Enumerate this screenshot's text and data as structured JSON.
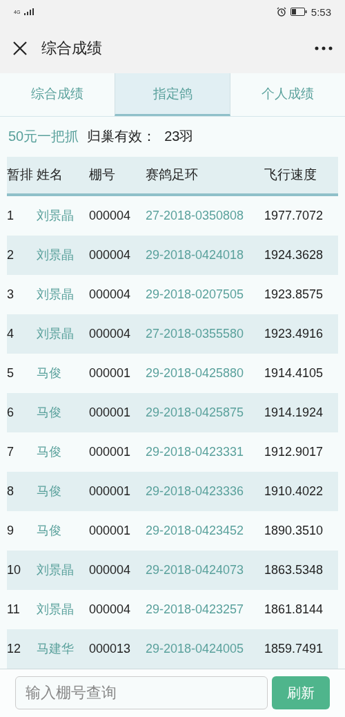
{
  "status_bar": {
    "network": "4G",
    "time": "5:53"
  },
  "header": {
    "title": "综合成绩"
  },
  "tabs": [
    {
      "label": "综合成绩",
      "selected": false
    },
    {
      "label": "指定鸽",
      "selected": true
    },
    {
      "label": "个人成绩",
      "selected": false
    }
  ],
  "summary": {
    "group": "50元一把抓",
    "label": "归巢有效：",
    "count": "23羽"
  },
  "table": {
    "columns": [
      "暂排",
      "姓名",
      "棚号",
      "赛鸽足环",
      "飞行速度"
    ],
    "rows": [
      [
        "1",
        "刘景晶",
        "000004",
        "27-2018-0350808",
        "1977.7072"
      ],
      [
        "2",
        "刘景晶",
        "000004",
        "29-2018-0424018",
        "1924.3628"
      ],
      [
        "3",
        "刘景晶",
        "000004",
        "29-2018-0207505",
        "1923.8575"
      ],
      [
        "4",
        "刘景晶",
        "000004",
        "27-2018-0355580",
        "1923.4916"
      ],
      [
        "5",
        "马俊",
        "000001",
        "29-2018-0425880",
        "1914.4105"
      ],
      [
        "6",
        "马俊",
        "000001",
        "29-2018-0425875",
        "1914.1924"
      ],
      [
        "7",
        "马俊",
        "000001",
        "29-2018-0423331",
        "1912.9017"
      ],
      [
        "8",
        "马俊",
        "000001",
        "29-2018-0423336",
        "1910.4022"
      ],
      [
        "9",
        "马俊",
        "000001",
        "29-2018-0423452",
        "1890.3510"
      ],
      [
        "10",
        "刘景晶",
        "000004",
        "29-2018-0424073",
        "1863.5348"
      ],
      [
        "11",
        "刘景晶",
        "000004",
        "29-2018-0423257",
        "1861.8144"
      ],
      [
        "12",
        "马建华",
        "000013",
        "29-2018-0424005",
        "1859.7491"
      ]
    ]
  },
  "search": {
    "placeholder": "输入棚号查询",
    "button": "刷新"
  }
}
